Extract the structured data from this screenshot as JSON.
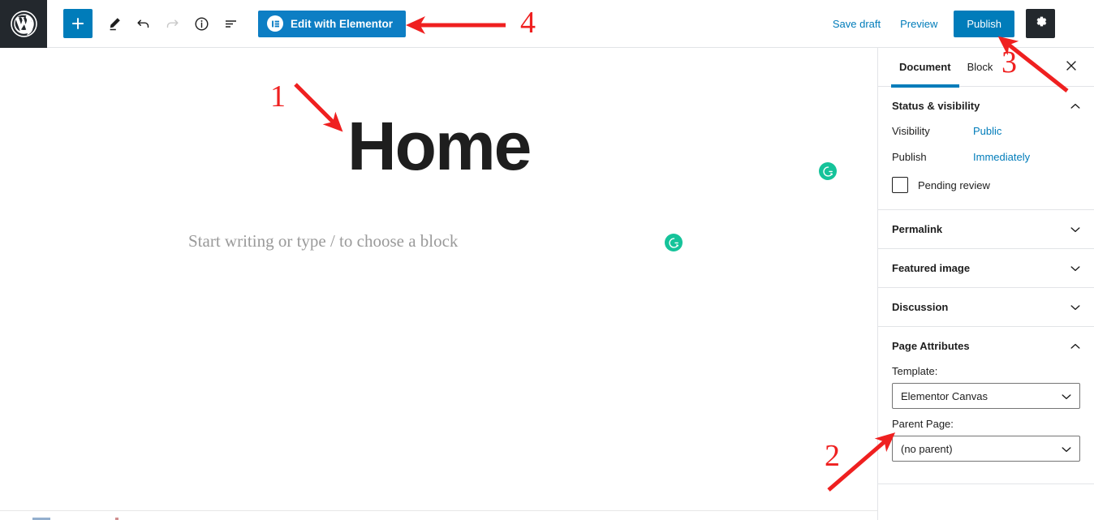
{
  "toolbar": {
    "wp_logo_name": "WordPress",
    "buttons": [
      {
        "name": "add-block",
        "icon": "plus-icon",
        "label": "Add block"
      },
      {
        "name": "edit-mode",
        "icon": "pencil-icon",
        "label": "Edit"
      },
      {
        "name": "undo",
        "icon": "undo-icon",
        "label": "Undo"
      },
      {
        "name": "redo",
        "icon": "redo-icon",
        "label": "Redo",
        "disabled": true
      },
      {
        "name": "details",
        "icon": "info-icon",
        "label": "Details"
      },
      {
        "name": "list-view",
        "icon": "list-view-icon",
        "label": "List view"
      }
    ],
    "elementor_label": "Edit with Elementor",
    "elementor_icon": "elementor-logo-icon",
    "save_draft_label": "Save draft",
    "preview_label": "Preview",
    "publish_label": "Publish",
    "settings_icon": "gear-icon",
    "more_icon": "kebab-menu-icon"
  },
  "editor": {
    "post_title": "Home",
    "block_placeholder": "Start writing or type / to choose a block",
    "grammarly_icon": "grammarly-icon"
  },
  "sidebar": {
    "tabs": [
      {
        "label": "Document",
        "active": true
      },
      {
        "label": "Block",
        "active": false
      }
    ],
    "close_icon": "close-icon",
    "panels": [
      {
        "title": "Status & visibility",
        "expanded": true,
        "rows": [
          {
            "label": "Visibility",
            "value": "Public"
          },
          {
            "label": "Publish",
            "value": "Immediately"
          }
        ],
        "checkbox_label": "Pending review",
        "checkbox_checked": false
      },
      {
        "title": "Permalink",
        "expanded": false
      },
      {
        "title": "Featured image",
        "expanded": false
      },
      {
        "title": "Discussion",
        "expanded": false
      },
      {
        "title": "Page Attributes",
        "expanded": true,
        "fields": [
          {
            "label": "Template:",
            "value": "Elementor Canvas"
          },
          {
            "label": "Parent Page:",
            "value": "(no parent)"
          }
        ]
      }
    ]
  },
  "annotations": {
    "color": "#ef2020",
    "items": [
      {
        "number": "1",
        "target": "post-title"
      },
      {
        "number": "2",
        "target": "template-select"
      },
      {
        "number": "3",
        "target": "publish-button"
      },
      {
        "number": "4",
        "target": "edit-with-elementor-button"
      }
    ]
  }
}
